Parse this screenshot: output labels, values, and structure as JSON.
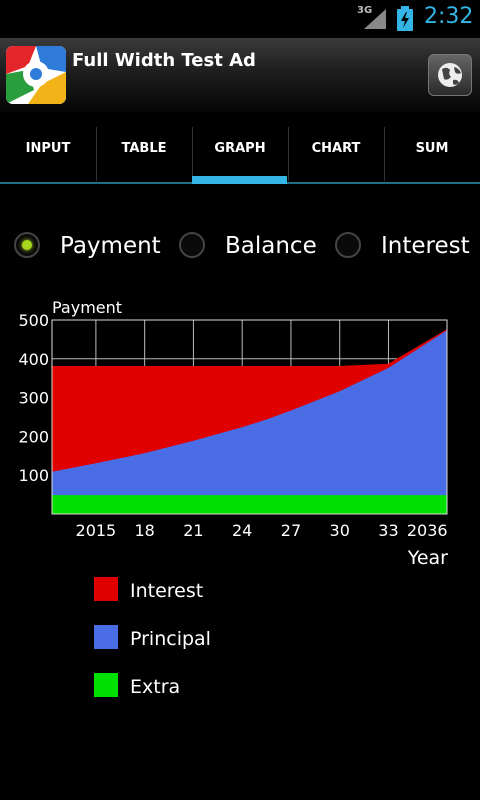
{
  "status_bar": {
    "network": "3G",
    "time": "2:32"
  },
  "ad": {
    "title": "Full Width Test Ad"
  },
  "tabs": [
    {
      "label": "INPUT",
      "selected": false
    },
    {
      "label": "TABLE",
      "selected": false
    },
    {
      "label": "GRAPH",
      "selected": true
    },
    {
      "label": "CHART",
      "selected": false
    },
    {
      "label": "SUM",
      "selected": false
    }
  ],
  "radios": [
    {
      "label": "Payment",
      "checked": true
    },
    {
      "label": "Balance",
      "checked": false
    },
    {
      "label": "Interest",
      "checked": false
    }
  ],
  "colors": {
    "interest": "#e00000",
    "principal": "#4a6de6",
    "extra": "#00e000",
    "accent": "#33b5e5"
  },
  "chart_data": {
    "type": "area",
    "title": "Payment",
    "xlabel": "Year",
    "ylabel": "Payment",
    "x_ticks": [
      "2015",
      "18",
      "21",
      "24",
      "27",
      "30",
      "33",
      "2036"
    ],
    "y_ticks": [
      "100",
      "200",
      "300",
      "400",
      "500"
    ],
    "xlim": [
      2012.3,
      2036.6
    ],
    "ylim": [
      0,
      500
    ],
    "grid": true,
    "stacked": true,
    "x": [
      2012.3,
      2015,
      2018,
      2021,
      2024,
      2025.5,
      2027,
      2030,
      2033,
      2036.6
    ],
    "series": [
      {
        "name": "Extra",
        "values": [
          50,
          50,
          50,
          50,
          50,
          50,
          50,
          50,
          50,
          50
        ]
      },
      {
        "name": "Principal",
        "values": [
          60,
          82,
          108,
          140,
          175,
          195,
          218,
          268,
          328,
          425
        ]
      },
      {
        "name": "Interest",
        "values": [
          270,
          248,
          222,
          190,
          155,
          135,
          112,
          62,
          8,
          0
        ]
      }
    ],
    "legend": [
      "Interest",
      "Principal",
      "Extra"
    ],
    "legend_position": "below"
  }
}
